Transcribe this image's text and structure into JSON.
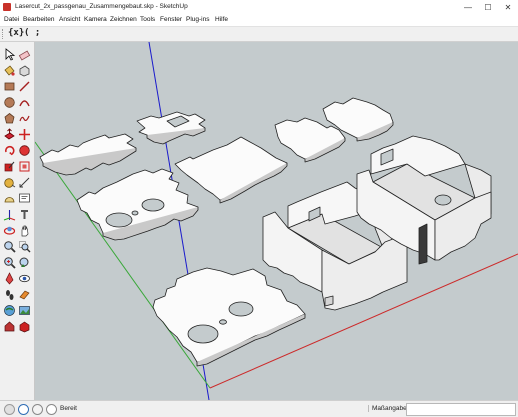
{
  "window": {
    "title": "Lasercut_2x_passgenau_Zusammengebaut.skp - SketchUp",
    "minimize": "—",
    "maximize": "☐",
    "close": "✕"
  },
  "menu": [
    "Datei",
    "Bearbeiten",
    "Ansicht",
    "Kamera",
    "Zeichnen",
    "Tools",
    "Fenster",
    "Plug-ins",
    "Hilfe"
  ],
  "toolbar": {
    "btn1": "{x}",
    "btn2": "( ;"
  },
  "tools": [
    "select-icon",
    "eraser-icon",
    "paint-bucket-icon",
    "make-component-icon",
    "rectangle-icon",
    "line-icon",
    "circle-icon",
    "arc-icon",
    "polygon-icon",
    "freehand-icon",
    "push-pull-icon",
    "move-icon",
    "rotate-icon",
    "follow-me-icon",
    "scale-icon",
    "offset-icon",
    "tape-measure-icon",
    "dimension-icon",
    "protractor-icon",
    "text-icon",
    "axes-icon",
    "3d-text-icon",
    "orbit-icon",
    "pan-icon",
    "zoom-icon",
    "zoom-window-icon",
    "zoom-extents-icon",
    "previous-view-icon",
    "position-camera-icon",
    "look-around-icon",
    "walk-icon",
    "section-plane-icon",
    "geo-location-icon",
    "photo-texture-icon",
    "warehouse-icon",
    "extension-icon"
  ],
  "status": {
    "text": "Bereit",
    "measure_label": "Maßangaben",
    "measure_value": ""
  }
}
